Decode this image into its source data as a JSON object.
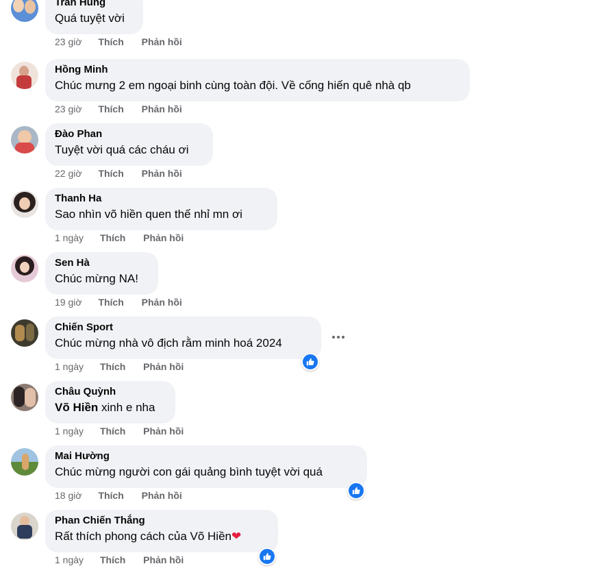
{
  "comments": [
    {
      "author": "Trần Hùng",
      "text": "Quá tuyệt vời",
      "time": "23 giờ",
      "like_label": "Thích",
      "reply_label": "Phản hồi"
    },
    {
      "author": "Hồng Minh",
      "text": "Chúc mưng 2 em ngoại binh cùng toàn đội. Về cống hiến quê nhà qb",
      "time": "23 giờ",
      "like_label": "Thích",
      "reply_label": "Phản hồi"
    },
    {
      "author": "Đào Phan",
      "text": "Tuyệt vời quá các cháu ơi",
      "time": "22 giờ",
      "like_label": "Thích",
      "reply_label": "Phản hồi"
    },
    {
      "author": "Thanh Ha",
      "text": "Sao nhìn võ hiền quen thế nhỉ mn ơi",
      "time": "1 ngày",
      "like_label": "Thích",
      "reply_label": "Phản hồi"
    },
    {
      "author": "Sen Hà",
      "text": "Chúc mừng NA!",
      "time": "19 giờ",
      "like_label": "Thích",
      "reply_label": "Phản hồi"
    },
    {
      "author": "Chiến Sport",
      "text": "Chúc mừng nhà vô địch rằm minh hoá 2024",
      "time": "1 ngày",
      "like_label": "Thích",
      "reply_label": "Phản hồi",
      "reaction": "like"
    },
    {
      "author": "Châu Quỳnh",
      "mention": "Võ Hiền",
      "text": " xinh e nha",
      "time": "1 ngày",
      "like_label": "Thích",
      "reply_label": "Phản hồi"
    },
    {
      "author": "Mai Hường",
      "text": "Chúc mừng người con gái quảng bình tuyệt vời quá",
      "time": "18 giờ",
      "like_label": "Thích",
      "reply_label": "Phản hồi",
      "reaction": "like"
    },
    {
      "author": "Phan Chiến Thắng",
      "text": "Rất thích phong cách của Võ Hiền",
      "emoji": "❤",
      "time": "1 ngày",
      "like_label": "Thích",
      "reply_label": "Phản hồi",
      "reaction": "like"
    }
  ],
  "colors": {
    "bubble": "#f0f2f5",
    "meta_text": "#65676b",
    "like_blue": "#1877f2",
    "heart": "#e41e3f"
  },
  "icons": {
    "reaction": "like-thumb-icon",
    "more": "more-options-icon"
  }
}
